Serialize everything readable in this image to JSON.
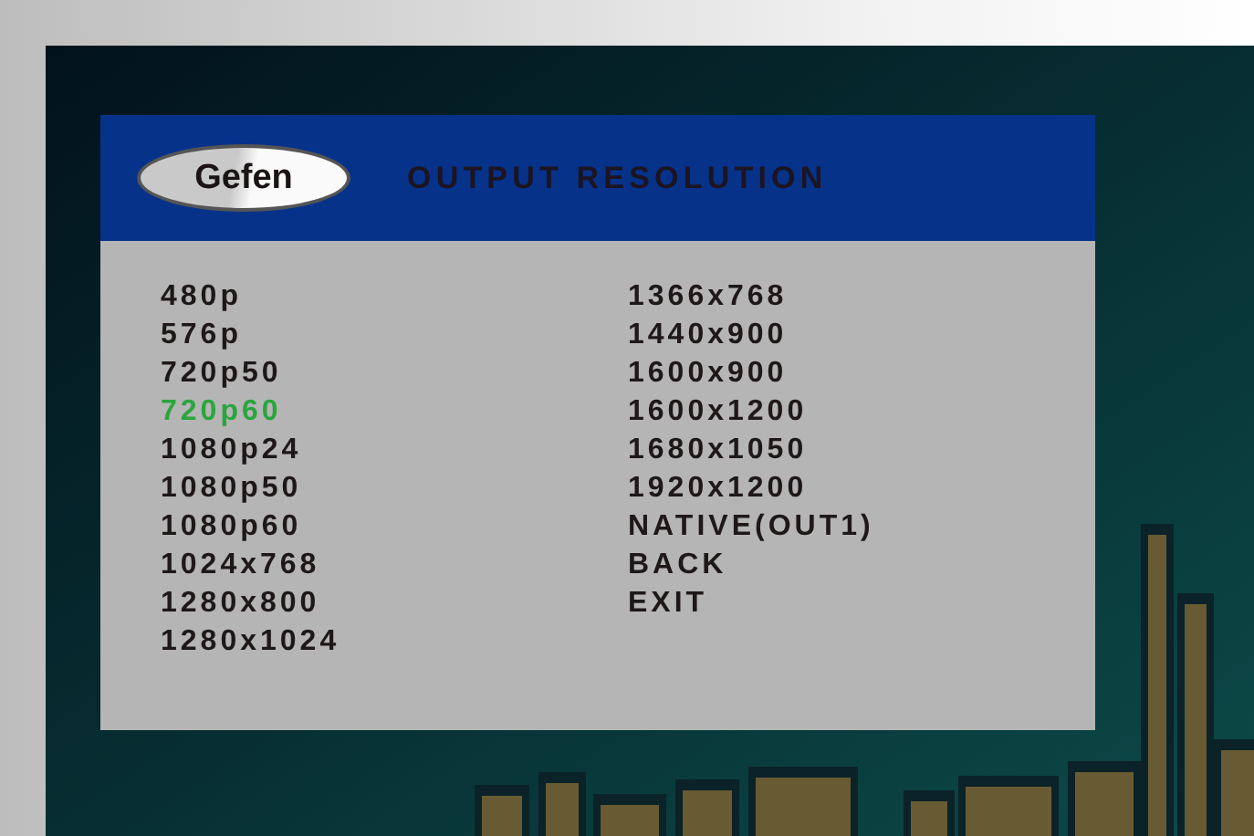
{
  "menu": {
    "logo": "Gefen",
    "title": "OUTPUT RESOLUTION",
    "columns": [
      [
        {
          "label": "480p",
          "selected": false
        },
        {
          "label": "576p",
          "selected": false
        },
        {
          "label": "720p50",
          "selected": false
        },
        {
          "label": "720p60",
          "selected": true
        },
        {
          "label": "1080p24",
          "selected": false
        },
        {
          "label": "1080p50",
          "selected": false
        },
        {
          "label": "1080p60",
          "selected": false
        },
        {
          "label": "1024x768",
          "selected": false
        },
        {
          "label": "1280x800",
          "selected": false
        },
        {
          "label": "1280x1024",
          "selected": false
        }
      ],
      [
        {
          "label": "1366x768",
          "selected": false
        },
        {
          "label": "1440x900",
          "selected": false
        },
        {
          "label": "1600x900",
          "selected": false
        },
        {
          "label": "1600x1200",
          "selected": false
        },
        {
          "label": "1680x1050",
          "selected": false
        },
        {
          "label": "1920x1200",
          "selected": false
        },
        {
          "label": "NATIVE(OUT1)",
          "selected": false
        },
        {
          "label": "BACK",
          "selected": false
        },
        {
          "label": "EXIT",
          "selected": false
        }
      ]
    ]
  }
}
